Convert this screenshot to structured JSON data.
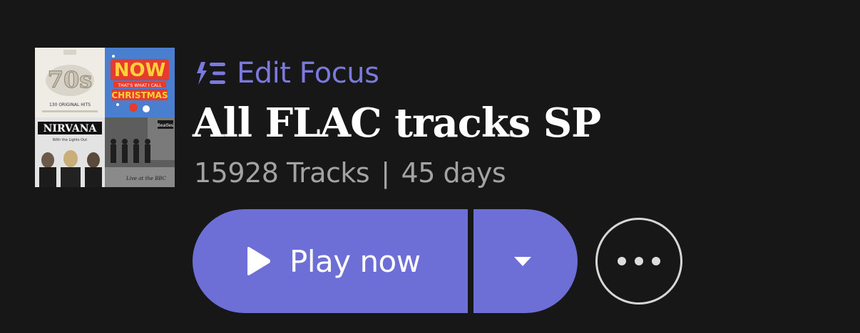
{
  "artwork": {
    "tiles": [
      {
        "name": "70s-album-tile",
        "text": "70s",
        "subtext": "130 ORIGINAL HITS"
      },
      {
        "name": "now-christmas-album-tile",
        "text": "NOW",
        "subtext": "CHRISTMAS"
      },
      {
        "name": "nirvana-album-tile",
        "text": "NIRVANA",
        "subtext": "With the Lights Out"
      },
      {
        "name": "beatles-album-tile",
        "text": "The Beatles",
        "subtext": "Live at the BBC"
      }
    ]
  },
  "focus": {
    "label": "Edit Focus",
    "icon": "focus-filter-icon",
    "color": "#7b78de"
  },
  "playlist": {
    "title": "All FLAC tracks SP",
    "track_count": "15928 Tracks",
    "separator": "|",
    "duration": "45 days"
  },
  "actions": {
    "play_label": "Play now",
    "play_icon": "play-icon",
    "dropdown_icon": "caret-down-icon",
    "more_icon": "more-options-icon",
    "accent_color": "#6d6fd6"
  }
}
